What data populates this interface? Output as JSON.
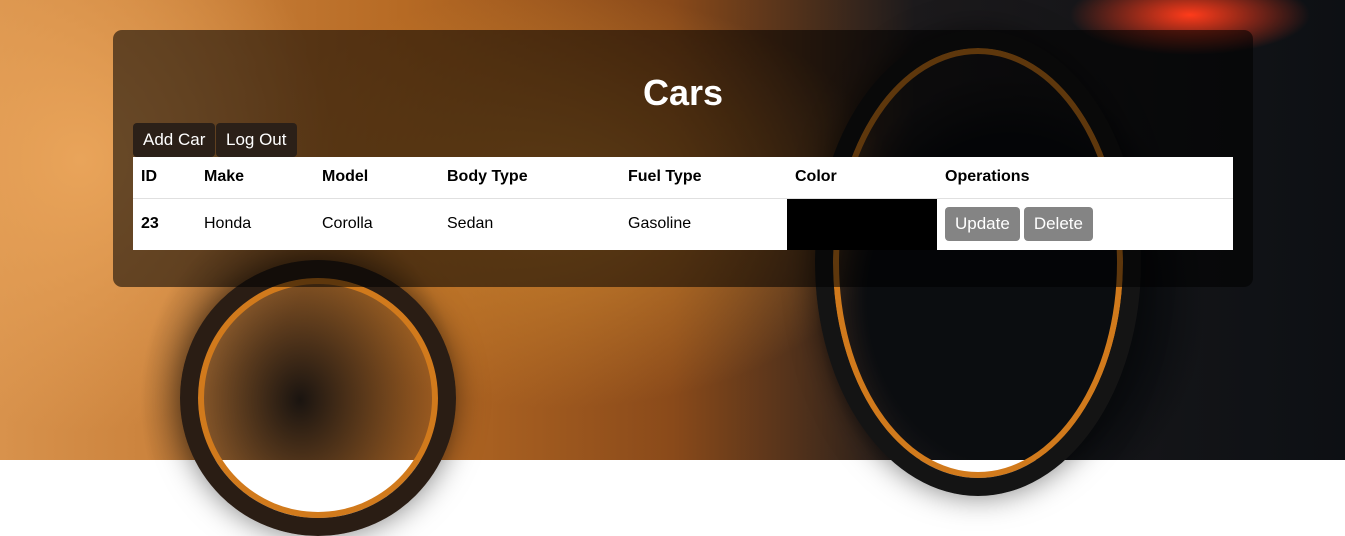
{
  "page": {
    "title": "Cars"
  },
  "toolbar": {
    "add_label": "Add Car",
    "logout_label": "Log Out"
  },
  "table": {
    "headers": [
      "ID",
      "Make",
      "Model",
      "Body Type",
      "Fuel Type",
      "Color",
      "Operations"
    ],
    "rows": [
      {
        "id": "23",
        "make": "Honda",
        "model": "Corolla",
        "body_type": "Sedan",
        "fuel_type": "Gasoline",
        "color": "#000000",
        "update_label": "Update",
        "delete_label": "Delete"
      }
    ]
  },
  "colors": {
    "panel": "rgba(0,0,0,0.55)",
    "dark_button": "#2b2018",
    "op_button": "#848484"
  }
}
